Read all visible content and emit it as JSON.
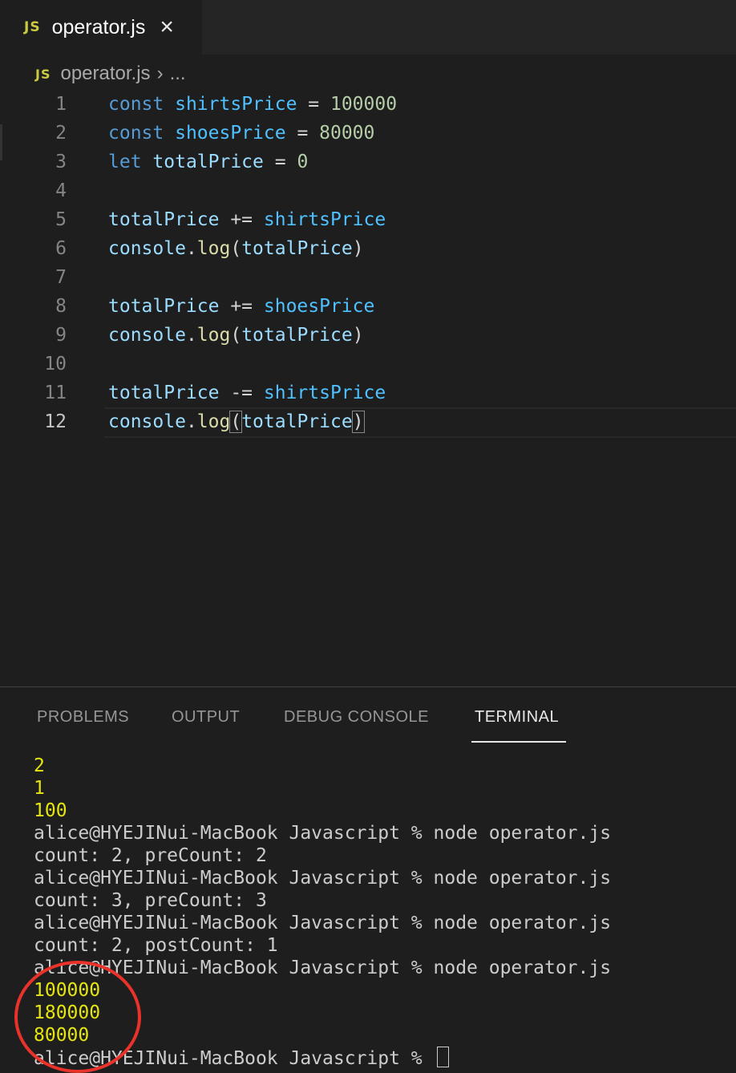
{
  "tab": {
    "badge": "JS",
    "title": "operator.js",
    "close": "×"
  },
  "breadcrumb": {
    "badge": "JS",
    "file": "operator.js",
    "separator": "›",
    "rest": "..."
  },
  "editor": {
    "active_line": 12,
    "lines": [
      {
        "num": "1",
        "tokens": [
          {
            "t": "const",
            "c": "kw"
          },
          {
            "t": " ",
            "c": "op"
          },
          {
            "t": "shirtsPrice",
            "c": "cv"
          },
          {
            "t": " = ",
            "c": "op"
          },
          {
            "t": "100000",
            "c": "nm"
          }
        ]
      },
      {
        "num": "2",
        "tokens": [
          {
            "t": "const",
            "c": "kw"
          },
          {
            "t": " ",
            "c": "op"
          },
          {
            "t": "shoesPrice",
            "c": "cv"
          },
          {
            "t": " = ",
            "c": "op"
          },
          {
            "t": "80000",
            "c": "nm"
          }
        ]
      },
      {
        "num": "3",
        "tokens": [
          {
            "t": "let",
            "c": "kw"
          },
          {
            "t": " ",
            "c": "op"
          },
          {
            "t": "totalPrice",
            "c": "vr"
          },
          {
            "t": " = ",
            "c": "op"
          },
          {
            "t": "0",
            "c": "nm"
          }
        ]
      },
      {
        "num": "4",
        "tokens": []
      },
      {
        "num": "5",
        "tokens": [
          {
            "t": "totalPrice",
            "c": "vr"
          },
          {
            "t": " += ",
            "c": "op"
          },
          {
            "t": "shirtsPrice",
            "c": "cv"
          }
        ]
      },
      {
        "num": "6",
        "tokens": [
          {
            "t": "console",
            "c": "vr"
          },
          {
            "t": ".",
            "c": "op"
          },
          {
            "t": "log",
            "c": "fn"
          },
          {
            "t": "(",
            "c": "op"
          },
          {
            "t": "totalPrice",
            "c": "vr"
          },
          {
            "t": ")",
            "c": "op"
          }
        ]
      },
      {
        "num": "7",
        "tokens": []
      },
      {
        "num": "8",
        "tokens": [
          {
            "t": "totalPrice",
            "c": "vr"
          },
          {
            "t": " += ",
            "c": "op"
          },
          {
            "t": "shoesPrice",
            "c": "cv"
          }
        ]
      },
      {
        "num": "9",
        "tokens": [
          {
            "t": "console",
            "c": "vr"
          },
          {
            "t": ".",
            "c": "op"
          },
          {
            "t": "log",
            "c": "fn"
          },
          {
            "t": "(",
            "c": "op"
          },
          {
            "t": "totalPrice",
            "c": "vr"
          },
          {
            "t": ")",
            "c": "op"
          }
        ]
      },
      {
        "num": "10",
        "tokens": []
      },
      {
        "num": "11",
        "tokens": [
          {
            "t": "totalPrice",
            "c": "vr"
          },
          {
            "t": " -= ",
            "c": "op"
          },
          {
            "t": "shirtsPrice",
            "c": "cv"
          }
        ]
      },
      {
        "num": "12",
        "tokens": [
          {
            "t": "console",
            "c": "vr"
          },
          {
            "t": ".",
            "c": "op"
          },
          {
            "t": "log",
            "c": "fn"
          },
          {
            "t": "(",
            "c": "op bracket"
          },
          {
            "t": "totalPrice",
            "c": "vr"
          },
          {
            "t": ")",
            "c": "op bracket"
          }
        ]
      }
    ]
  },
  "panel": {
    "tabs": [
      "PROBLEMS",
      "OUTPUT",
      "DEBUG CONSOLE",
      "TERMINAL"
    ],
    "active_tab": "TERMINAL"
  },
  "terminal": {
    "lines": [
      {
        "text": "2",
        "color": "yellow"
      },
      {
        "text": "1",
        "color": "yellow"
      },
      {
        "text": "100",
        "color": "yellow"
      },
      {
        "text": "alice@HYEJINui-MacBook Javascript % node operator.js",
        "color": "default"
      },
      {
        "text": "count: 2, preCount: 2",
        "color": "default"
      },
      {
        "text": "alice@HYEJINui-MacBook Javascript % node operator.js",
        "color": "default"
      },
      {
        "text": "count: 3, preCount: 3",
        "color": "default"
      },
      {
        "text": "alice@HYEJINui-MacBook Javascript % node operator.js",
        "color": "default"
      },
      {
        "text": "count: 2, postCount: 1",
        "color": "default"
      },
      {
        "text": "alice@HYEJINui-MacBook Javascript % node operator.js",
        "color": "default"
      },
      {
        "text": "100000",
        "color": "yellow"
      },
      {
        "text": "180000",
        "color": "yellow"
      },
      {
        "text": "80000",
        "color": "yellow"
      }
    ],
    "prompt": "alice@HYEJINui-MacBook Javascript % "
  },
  "annotation": {
    "shape": "circle",
    "color": "#e8322a"
  }
}
